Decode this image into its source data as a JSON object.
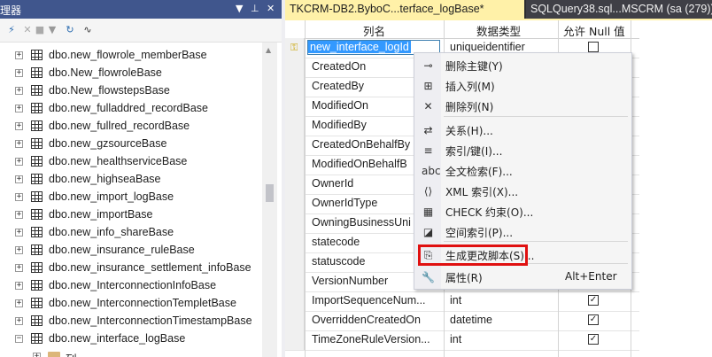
{
  "explorer": {
    "title": "理器",
    "controls": {
      "dropdown": "▼",
      "pin": "⊥",
      "close": "✕"
    },
    "toolbar_icons": [
      "connect-icon",
      "disconnect-icon",
      "stop-icon",
      "filter-icon",
      "refresh-icon",
      "activity-icon"
    ],
    "items": [
      {
        "label": "dbo.new_flowrole_memberBase",
        "expander": "+"
      },
      {
        "label": "dbo.New_flowroleBase",
        "expander": "+"
      },
      {
        "label": "dbo.New_flowstepsBase",
        "expander": "+"
      },
      {
        "label": "dbo.new_fulladdred_recordBase",
        "expander": "+"
      },
      {
        "label": "dbo.new_fullred_recordBase",
        "expander": "+"
      },
      {
        "label": "dbo.new_gzsourceBase",
        "expander": "+"
      },
      {
        "label": "dbo.new_healthserviceBase",
        "expander": "+"
      },
      {
        "label": "dbo.new_highseaBase",
        "expander": "+"
      },
      {
        "label": "dbo.new_import_logBase",
        "expander": "+"
      },
      {
        "label": "dbo.new_importBase",
        "expander": "+"
      },
      {
        "label": "dbo.new_info_shareBase",
        "expander": "+"
      },
      {
        "label": "dbo.new_insurance_ruleBase",
        "expander": "+"
      },
      {
        "label": "dbo.new_insurance_settlement_infoBase",
        "expander": "+"
      },
      {
        "label": "dbo.new_InterconnectionInfoBase",
        "expander": "+"
      },
      {
        "label": "dbo.new_InterconnectionTempletBase",
        "expander": "+"
      },
      {
        "label": "dbo.new_InterconnectionTimestampBase",
        "expander": "+"
      },
      {
        "label": "dbo.new_interface_logBase",
        "expander": "−"
      }
    ],
    "child_folder": {
      "label": "列",
      "expander": "+"
    }
  },
  "tabs": [
    {
      "label": "TKCRM-DB2.ByboC...terface_logBase*",
      "active": true
    },
    {
      "label": "SQLQuery38.sql...MSCRM (sa (279))",
      "active": false
    }
  ],
  "grid": {
    "headers": {
      "column_name": "列名",
      "data_type": "数据类型",
      "allow_null": "允许 Null 值"
    },
    "rows": [
      {
        "name": "new_interface_logId",
        "type": "uniqueidentifier",
        "null": false,
        "key": true,
        "selected": true
      },
      {
        "name": "CreatedOn",
        "type": "",
        "null": null
      },
      {
        "name": "CreatedBy",
        "type": "",
        "null": null
      },
      {
        "name": "ModifiedOn",
        "type": "",
        "null": null
      },
      {
        "name": "ModifiedBy",
        "type": "",
        "null": null
      },
      {
        "name": "CreatedOnBehalfBy",
        "type": "",
        "null": null
      },
      {
        "name": "ModifiedOnBehalfB",
        "type": "",
        "null": null
      },
      {
        "name": "OwnerId",
        "type": "",
        "null": null
      },
      {
        "name": "OwnerIdType",
        "type": "",
        "null": null
      },
      {
        "name": "OwningBusinessUni",
        "type": "",
        "null": null
      },
      {
        "name": "statecode",
        "type": "",
        "null": null
      },
      {
        "name": "statuscode",
        "type": "",
        "null": null
      },
      {
        "name": "VersionNumber",
        "type": "",
        "null": null
      },
      {
        "name": "ImportSequenceNum...",
        "type": "int",
        "null": true
      },
      {
        "name": "OverriddenCreatedOn",
        "type": "datetime",
        "null": true
      },
      {
        "name": "TimeZoneRuleVersion...",
        "type": "int",
        "null": true
      }
    ],
    "check_glyph": "✓"
  },
  "context_menu": {
    "items": [
      {
        "label": "删除主键(Y)",
        "icon": "key-icon",
        "glyph": "⊸"
      },
      {
        "label": "插入列(M)",
        "icon": "insert-column-icon",
        "glyph": "⊞"
      },
      {
        "label": "删除列(N)",
        "icon": "delete-column-icon",
        "glyph": "✕"
      },
      {
        "label": "关系(H)...",
        "icon": "relationship-icon",
        "glyph": "⇄"
      },
      {
        "label": "索引/键(I)...",
        "icon": "index-icon",
        "glyph": "≡"
      },
      {
        "label": "全文检索(F)...",
        "icon": "fulltext-icon",
        "glyph": "abc"
      },
      {
        "label": "XML 索引(X)...",
        "icon": "xml-index-icon",
        "glyph": "⟨⟩"
      },
      {
        "label": "CHECK 约束(O)...",
        "icon": "check-constraint-icon",
        "glyph": "▦"
      },
      {
        "label": "空间索引(P)...",
        "icon": "spatial-index-icon",
        "glyph": "◪"
      },
      {
        "label": "生成更改脚本(S)...",
        "icon": "generate-script-icon",
        "glyph": "⎘"
      },
      {
        "label": "属性(R)",
        "icon": "properties-icon",
        "glyph": "🔧",
        "shortcut": "Alt+Enter"
      }
    ]
  },
  "colors": {
    "tab_active": "#fff1a8",
    "highlight": "#e01010",
    "title_bar": "#40568d"
  }
}
